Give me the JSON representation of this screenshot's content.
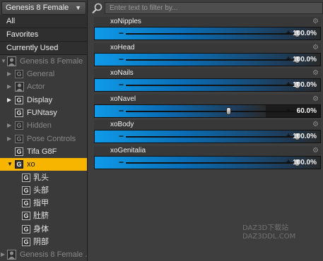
{
  "left_panel": {
    "figure_select": {
      "value": "Genesis 8 Female",
      "arrow_icon": "dropdown-arrow-icon"
    },
    "categories": [
      "All",
      "Favorites",
      "Currently Used"
    ],
    "tree": [
      {
        "label": "Genesis 8 Female",
        "expanded": true,
        "dim": true,
        "icon": "figure-icon"
      },
      {
        "label": "General",
        "expanded": false,
        "dim": true,
        "icon": "group-icon"
      },
      {
        "label": "Actor",
        "expanded": false,
        "dim": true,
        "icon": "figure-icon"
      },
      {
        "label": "Display",
        "expanded": false,
        "dim": false,
        "icon": "group-icon"
      },
      {
        "label": "FUNtasy",
        "expanded": false,
        "dim": false,
        "icon": "group-icon"
      },
      {
        "label": "Hidden",
        "expanded": false,
        "dim": true,
        "icon": "group-icon"
      },
      {
        "label": "Pose Controls",
        "expanded": false,
        "dim": true,
        "icon": "group-icon"
      },
      {
        "label": "Tifa G8F",
        "expanded": false,
        "dim": false,
        "icon": "group-icon"
      },
      {
        "label": "xo",
        "expanded": true,
        "dim": false,
        "icon": "group-icon",
        "selected": true
      },
      {
        "label": "乳头",
        "dim": false,
        "icon": "group-icon"
      },
      {
        "label": "头部",
        "dim": false,
        "icon": "group-icon"
      },
      {
        "label": "指甲",
        "dim": false,
        "icon": "group-icon"
      },
      {
        "label": "肚脐",
        "dim": false,
        "icon": "group-icon"
      },
      {
        "label": "身体",
        "dim": false,
        "icon": "group-icon"
      },
      {
        "label": "阴部",
        "dim": false,
        "icon": "group-icon"
      },
      {
        "label": "Genesis 8 Female ...",
        "expanded": false,
        "dim": true,
        "icon": "figure-icon"
      }
    ],
    "group_icon_letter": "G",
    "selection_color": "#f7b500"
  },
  "right_panel": {
    "search": {
      "placeholder": "Enter text to filter by...",
      "value": ""
    },
    "sliders": [
      {
        "name": "xoNipples",
        "value": 1.0,
        "display": "100.0%"
      },
      {
        "name": "xoHead",
        "value": 1.0,
        "display": "100.0%"
      },
      {
        "name": "xoNails",
        "value": 1.0,
        "display": "100.0%"
      },
      {
        "name": "xoNavel",
        "value": 0.6,
        "display": "60.0%"
      },
      {
        "name": "xoBody",
        "value": 1.0,
        "display": "100.0%"
      },
      {
        "name": "xoGenitalia",
        "value": 1.0,
        "display": "100.0%"
      }
    ],
    "accent_color": "#0f9ae8"
  },
  "watermark": [
    "DAZ3D下载站",
    "DAZ3DDL.COM"
  ]
}
